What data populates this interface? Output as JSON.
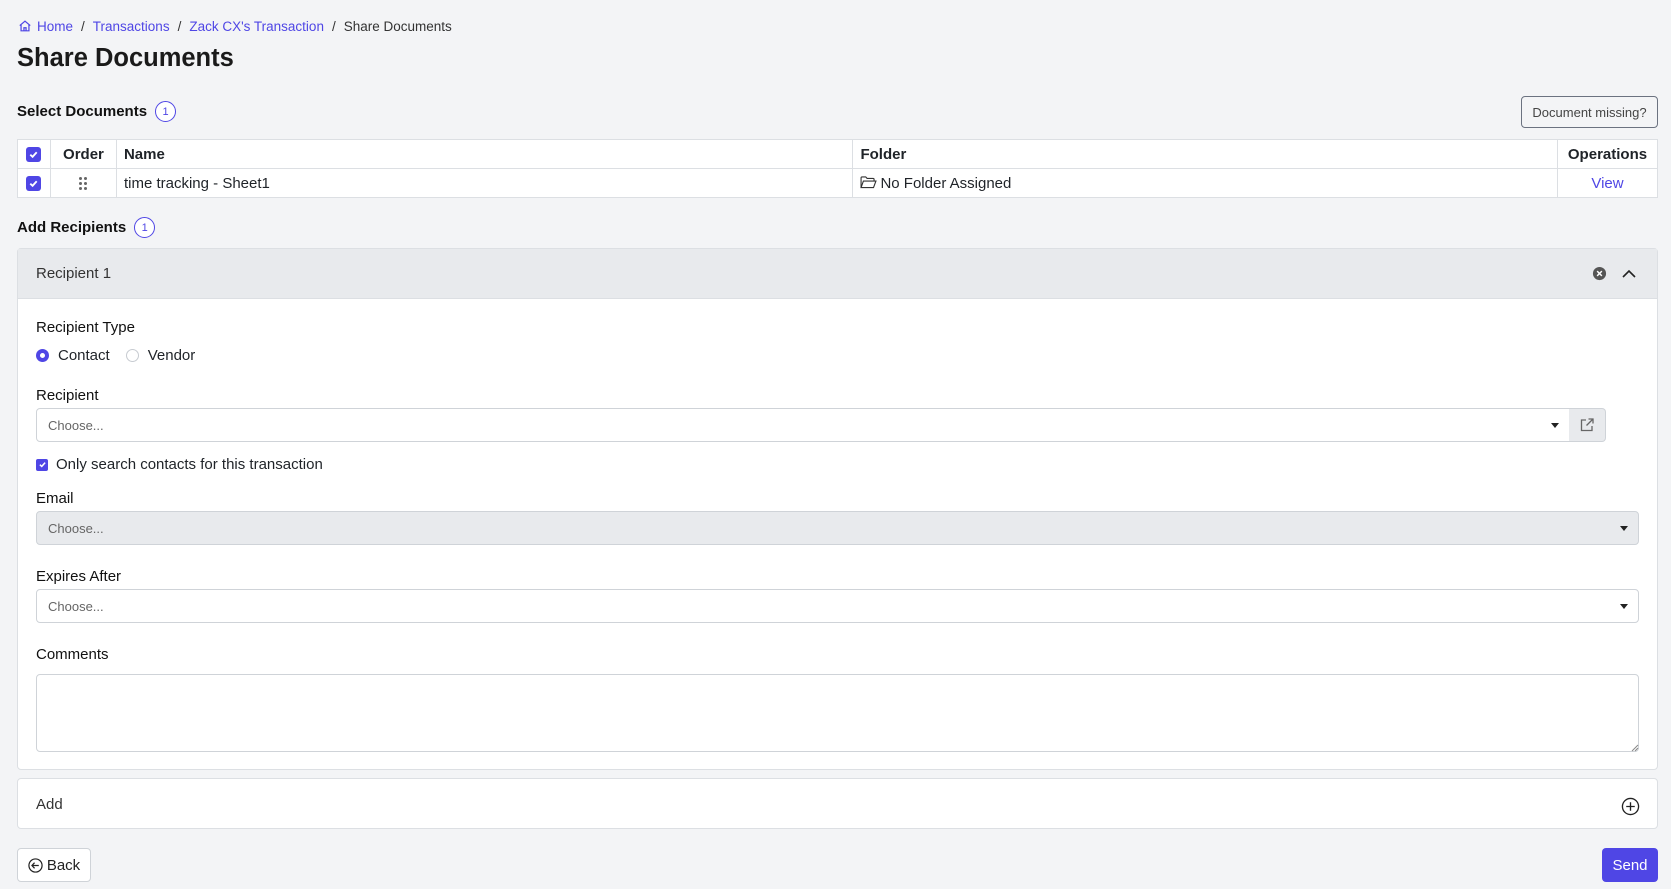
{
  "breadcrumb": {
    "home": "Home",
    "transactions": "Transactions",
    "transaction": "Zack CX's Transaction",
    "current": "Share Documents",
    "separator": "/"
  },
  "page_title": "Share Documents",
  "select_documents": {
    "title": "Select Documents",
    "count": "1",
    "missing_button": "Document missing?",
    "columns": {
      "order": "Order",
      "name": "Name",
      "folder": "Folder",
      "operations": "Operations"
    },
    "rows": [
      {
        "checked": true,
        "name": "time tracking - Sheet1",
        "folder": "No Folder Assigned",
        "operation": "View"
      }
    ]
  },
  "add_recipients": {
    "title": "Add Recipients",
    "count": "1",
    "recipient": {
      "title": "Recipient 1",
      "type_label": "Recipient Type",
      "type_options": [
        "Contact",
        "Vendor"
      ],
      "type_selected": "Contact",
      "recipient_label": "Recipient",
      "recipient_placeholder": "Choose...",
      "only_search_label": "Only search contacts for this transaction",
      "only_search_checked": true,
      "email_label": "Email",
      "email_placeholder": "Choose...",
      "expires_label": "Expires After",
      "expires_placeholder": "Choose...",
      "comments_label": "Comments",
      "comments_value": ""
    },
    "add_label": "Add"
  },
  "footer": {
    "back": "Back",
    "send": "Send"
  },
  "colors": {
    "accent": "#4f46e5",
    "background": "#f3f4f6"
  },
  "icons": [
    "home-icon",
    "folder-open-icon",
    "drag-grip-icon",
    "close-circle-icon",
    "chevron-up-icon",
    "external-link-icon",
    "plus-circle-icon",
    "arrow-left-circle-icon",
    "caret-down-icon"
  ]
}
